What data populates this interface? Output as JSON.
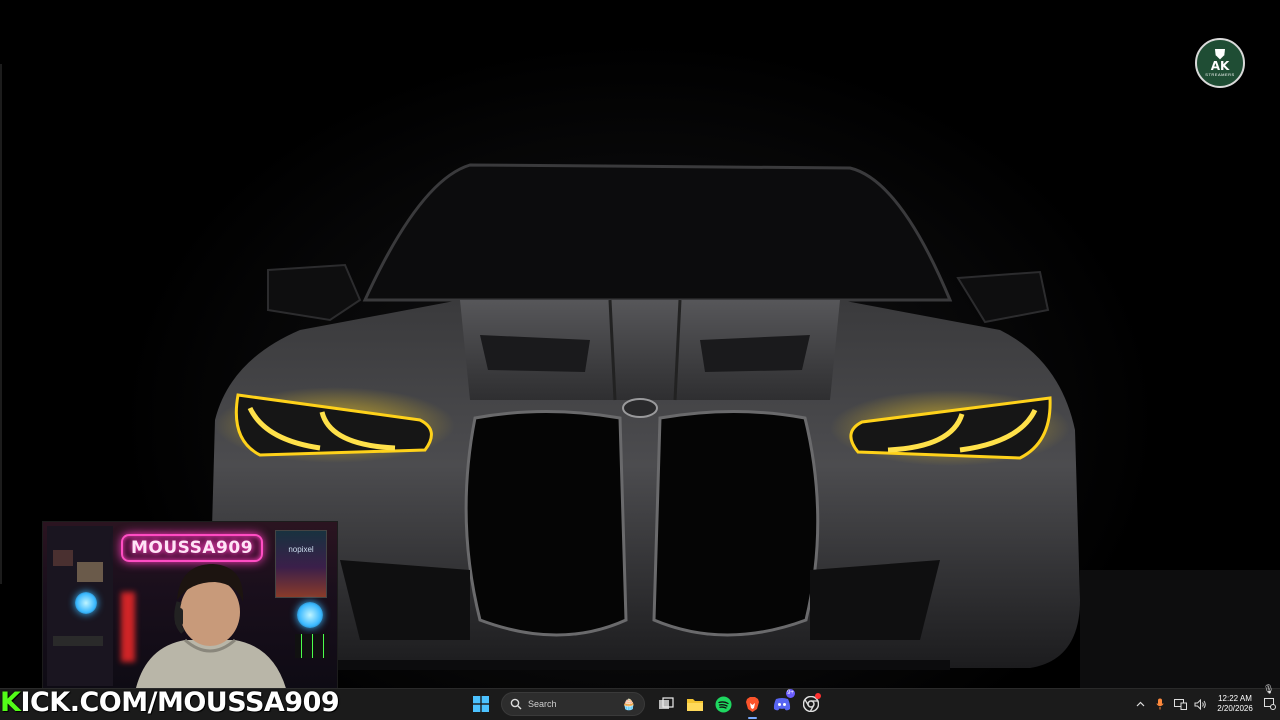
{
  "overlay": {
    "logo_text": "AK",
    "logo_subtext": "STREAMERS",
    "kick_prefix": "K",
    "kick_url": "ICK.COM/MOUSSA909"
  },
  "webcam": {
    "neon_sign": "MOUSSA909",
    "poster_text": "nopixel"
  },
  "taskbar": {
    "search_placeholder": "Search",
    "pinned_apps": [
      "windows-start",
      "search",
      "task-view",
      "file-explorer",
      "spotify",
      "brave-browser",
      "discord",
      "chrome-canary"
    ],
    "discord_badge": "9+",
    "clock_time": "12:22 AM",
    "clock_date": "2/20/2026"
  },
  "colors": {
    "headlight": "#ffd21a",
    "kick_green": "#53fc18",
    "neon_pink": "#ff3ebd",
    "taskbar_bg": "#1b1b1b"
  }
}
